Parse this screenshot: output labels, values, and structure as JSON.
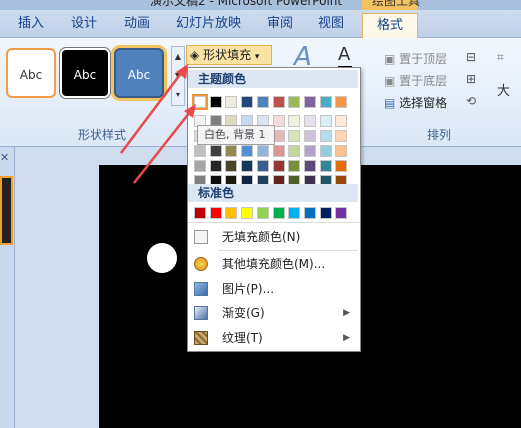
{
  "window": {
    "title": "演示文稿2 - Microsoft PowerPoint",
    "context_tab_group": "绘图工具"
  },
  "tabs": [
    {
      "label": "插入"
    },
    {
      "label": "设计"
    },
    {
      "label": "动画"
    },
    {
      "label": "幻灯片放映"
    },
    {
      "label": "审阅"
    },
    {
      "label": "视图"
    },
    {
      "label": "格式",
      "active": true
    }
  ],
  "ribbon": {
    "shape_style_thumbs": [
      "Abc",
      "Abc",
      "Abc"
    ],
    "shape_styles_group": "形状样式",
    "fill_button": "形状填充",
    "arrange_group": "排列",
    "arrange_items": [
      "置于顶层",
      "置于底层",
      "选择窗格"
    ],
    "right_partial": "大"
  },
  "fill_menu": {
    "theme_colors_header": "主题颜色",
    "standard_colors_header": "标准色",
    "theme_top_row": [
      "#ffffff",
      "#000000",
      "#eeece1",
      "#1f497d",
      "#4f81bd",
      "#c0504d",
      "#9bbb59",
      "#8064a2",
      "#4bacc6",
      "#f79646"
    ],
    "theme_shades": [
      [
        "#f2f2f2",
        "#7f7f7f",
        "#ddd9c3",
        "#c6d9f0",
        "#dbe5f1",
        "#f2dcdb",
        "#ebf1dd",
        "#e5e0ec",
        "#dbeef3",
        "#fdeada"
      ],
      [
        "#d8d8d8",
        "#595959",
        "#c4bd97",
        "#8db3e2",
        "#b8cce4",
        "#e5b9b7",
        "#d7e3bc",
        "#ccc1d9",
        "#b7dde8",
        "#fbd5b5"
      ],
      [
        "#bfbfbf",
        "#3f3f3f",
        "#938953",
        "#548dd4",
        "#95b3d7",
        "#d99694",
        "#c3d69b",
        "#b2a2c7",
        "#92cddc",
        "#fac08f"
      ],
      [
        "#a5a5a5",
        "#262626",
        "#494429",
        "#17365d",
        "#366092",
        "#953734",
        "#76923c",
        "#5f497a",
        "#31859b",
        "#e36c09"
      ],
      [
        "#7f7f7f",
        "#0c0c0c",
        "#1d1b10",
        "#0f243e",
        "#244061",
        "#632423",
        "#4f6128",
        "#3f3151",
        "#205867",
        "#974806"
      ]
    ],
    "standard_colors": [
      "#c00000",
      "#ff0000",
      "#ffc000",
      "#ffff00",
      "#92d050",
      "#00b050",
      "#00b0f0",
      "#0070c0",
      "#002060",
      "#7030a0"
    ],
    "tooltip": "白色, 背景 1",
    "items": [
      {
        "label": "无填充颜色(N)",
        "icon": "no-fill-icon",
        "submenu": false
      },
      {
        "label": "其他填充颜色(M)...",
        "icon": "palette-icon",
        "submenu": false
      },
      {
        "label": "图片(P)...",
        "icon": "picture-icon",
        "submenu": false
      },
      {
        "label": "渐变(G)",
        "icon": "gradient-icon",
        "submenu": true
      },
      {
        "label": "纹理(T)",
        "icon": "texture-icon",
        "submenu": true
      }
    ]
  },
  "colors": {
    "accent_highlight": "#f29436",
    "annotation_arrow": "#e84a4a"
  }
}
